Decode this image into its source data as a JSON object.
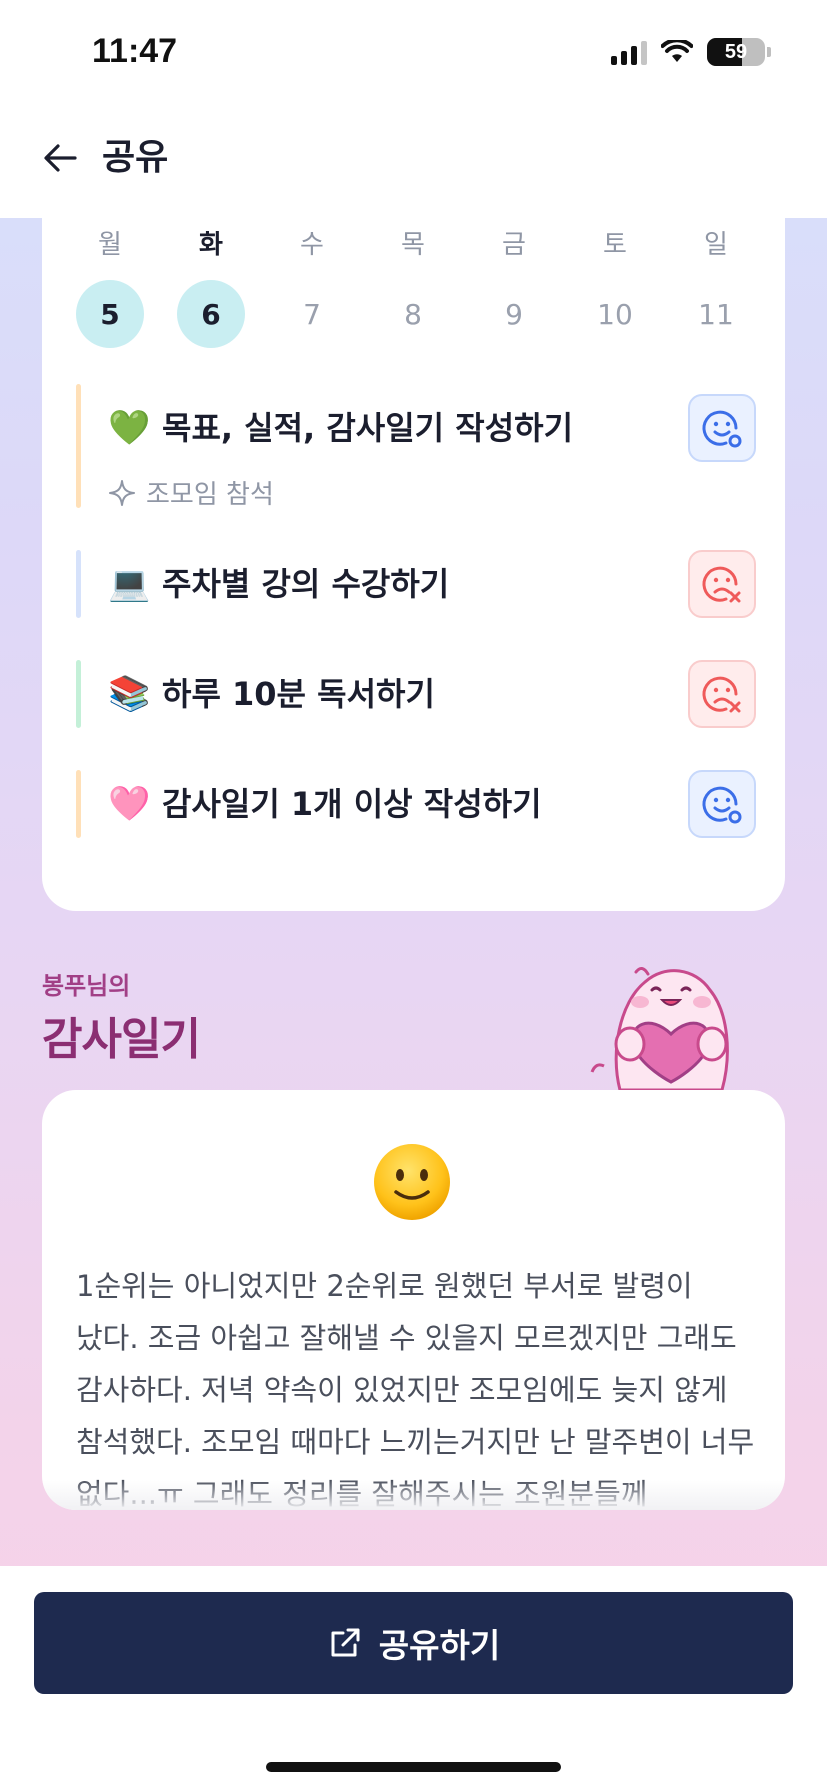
{
  "status_bar": {
    "time": "11:47",
    "battery": "59"
  },
  "header": {
    "title": "공유",
    "back_icon": "arrow-left-icon"
  },
  "week": {
    "days": [
      "월",
      "화",
      "수",
      "목",
      "금",
      "토",
      "일"
    ],
    "dates": [
      "5",
      "6",
      "7",
      "8",
      "9",
      "10",
      "11"
    ],
    "completed": [
      true,
      true,
      false,
      false,
      false,
      false,
      false
    ],
    "today_index": 1
  },
  "tasks": [
    {
      "emoji": "💚",
      "title": "목표, 실적, 감사일기 작성하기",
      "sub": "조모임 참석",
      "sub_icon": "sparkle-icon",
      "status": "ok",
      "bar_color": "#ffe0b8"
    },
    {
      "emoji": "💻",
      "title": "주차별 강의 수강하기",
      "status": "fail",
      "bar_color": "#d6e2fb"
    },
    {
      "emoji": "📚",
      "title": "하루 10분 독서하기",
      "status": "fail",
      "bar_color": "#c4f0d8"
    },
    {
      "emoji": "🩷",
      "title": "감사일기 1개 이상 작성하기",
      "status": "ok",
      "bar_color": "#ffe0b8"
    }
  ],
  "journal": {
    "owner": "봉푸님의",
    "title": "감사일기",
    "mood": "smiling-face-icon",
    "text": "1순위는 아니었지만 2순위로 원했던 부서로 발령이 났다. 조금 아쉽고 잘해낼 수 있을지 모르겠지만 그래도 감사하다. 저녁 약속이 있었지만 조모임에도 늦지 않게 참석했다. 조모임 때마다 느끼는거지만 난 말주변이 너무 없다...ㅠ 그래도 정리를 잘해주시는 조원분들께 감사하다!"
  },
  "share_button": {
    "label": "공유하기",
    "icon": "external-link-icon"
  },
  "colors": {
    "primary": "#1e2a4f",
    "accent_pink": "#8b2e72",
    "done_circle": "#c9eef2"
  }
}
